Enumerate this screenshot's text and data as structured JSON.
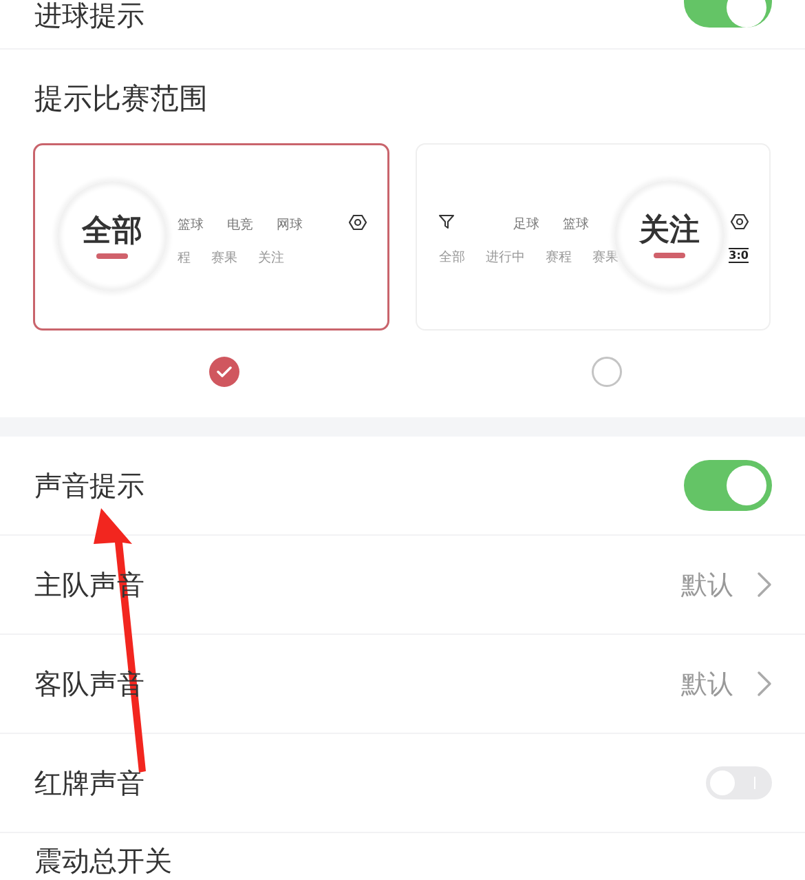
{
  "top_row": {
    "label": "进球提示",
    "on": true
  },
  "scope": {
    "title": "提示比赛范围",
    "options": [
      {
        "kind": "all",
        "badge": "全部",
        "selected": true,
        "row1": [
          "篮球",
          "电竞",
          "网球"
        ],
        "row2": [
          "程",
          "赛果",
          "关注"
        ]
      },
      {
        "kind": "follow",
        "badge": "关注",
        "selected": false,
        "row1": [
          "足球",
          "篮球"
        ],
        "row2": [
          "全部",
          "进行中",
          "赛程",
          "赛果"
        ],
        "score": "3:0"
      }
    ]
  },
  "rows": [
    {
      "kind": "toggle",
      "label": "声音提示",
      "on": true
    },
    {
      "kind": "link",
      "label": "主队声音",
      "value": "默认"
    },
    {
      "kind": "link",
      "label": "客队声音",
      "value": "默认"
    },
    {
      "kind": "toggle",
      "label": "红牌声音",
      "on": false
    },
    {
      "kind": "plain",
      "label": "震动总开关"
    }
  ]
}
